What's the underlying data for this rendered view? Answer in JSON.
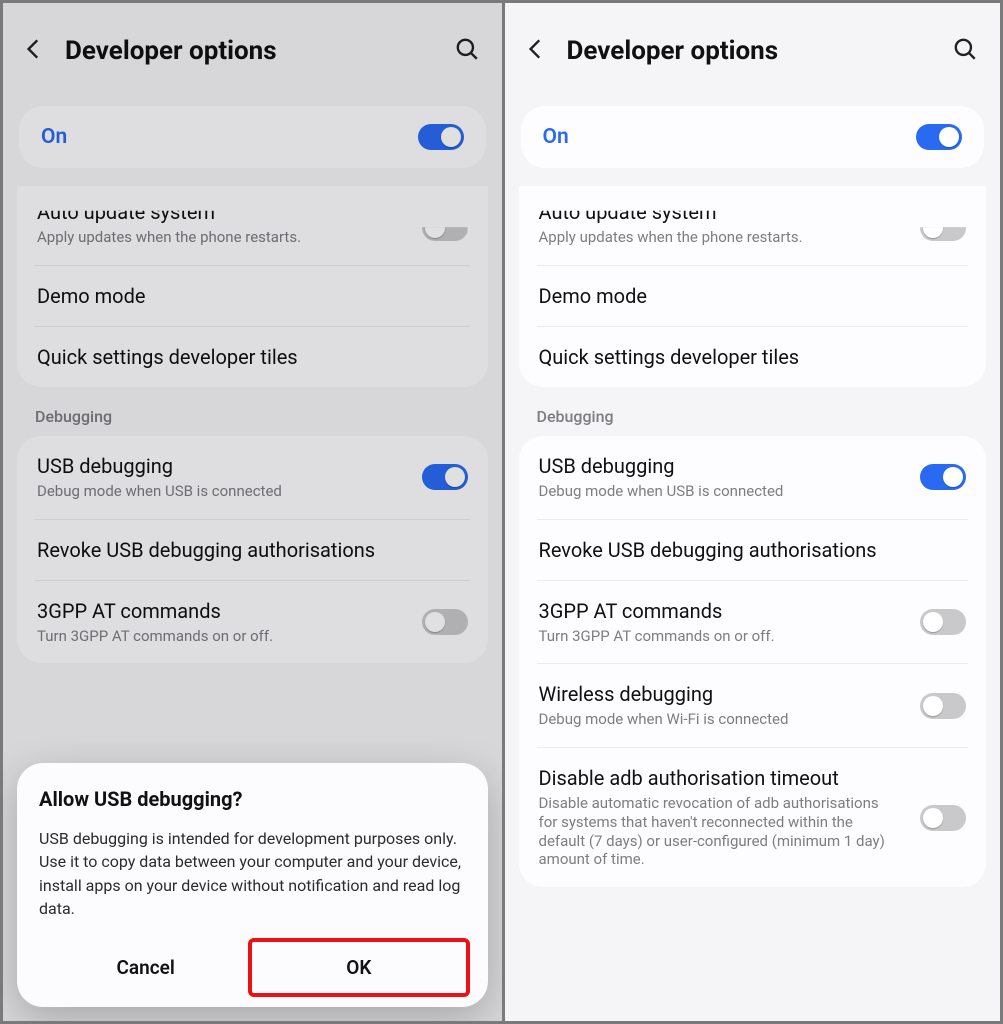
{
  "header": {
    "title": "Developer options"
  },
  "master_toggle": {
    "label": "On",
    "state": true
  },
  "section1": {
    "auto_update": {
      "title": "Auto update system",
      "sub": "Apply updates when the phone restarts.",
      "state": false
    },
    "demo_mode": {
      "title": "Demo mode"
    },
    "quick_tiles": {
      "title": "Quick settings developer tiles"
    }
  },
  "debugging_header": "Debugging",
  "debugging": {
    "usb": {
      "title": "USB debugging",
      "sub": "Debug mode when USB is connected",
      "state": true
    },
    "revoke": {
      "title": "Revoke USB debugging authorisations"
    },
    "gpp": {
      "title": "3GPP AT commands",
      "sub": "Turn 3GPP AT commands on or off.",
      "state": false
    },
    "wireless": {
      "title": "Wireless debugging",
      "sub": "Debug mode when Wi-Fi is connected",
      "state": false
    },
    "adb_to": {
      "title": "Disable adb authorisation timeout",
      "sub": "Disable automatic revocation of adb authorisations for systems that haven't reconnected within the default (7 days) or user-configured (minimum 1 day) amount of time.",
      "state": false
    }
  },
  "dialog": {
    "title": "Allow USB debugging?",
    "body": "USB debugging is intended for development purposes only. Use it to copy data between your computer and your device, install apps on your device without notification and read log data.",
    "cancel": "Cancel",
    "ok": "OK"
  }
}
